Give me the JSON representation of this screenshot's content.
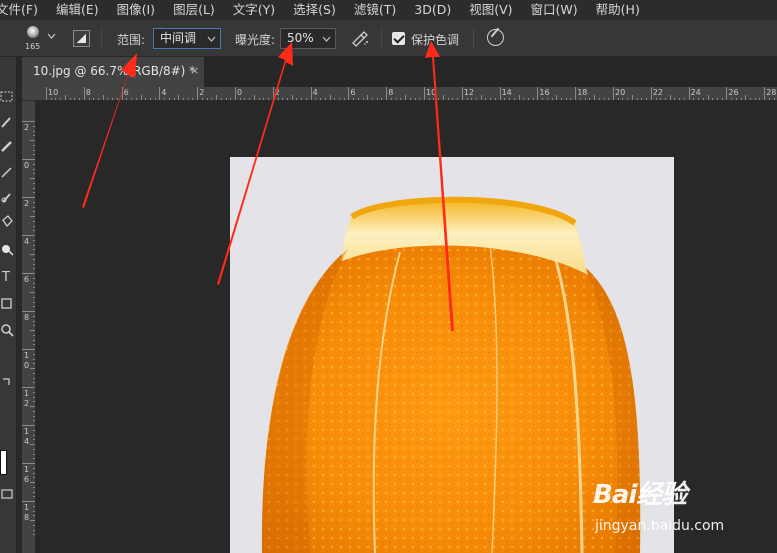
{
  "menu": [
    "文件(F)",
    "编辑(E)",
    "图像(I)",
    "图层(L)",
    "文字(Y)",
    "选择(S)",
    "滤镜(T)",
    "3D(D)",
    "视图(V)",
    "窗口(W)",
    "帮助(H)"
  ],
  "options": {
    "brush_size": "165",
    "range_label": "范围:",
    "range_value": "中间调",
    "exposure_label": "曝光度:",
    "exposure_value": "50%",
    "protect_tones_label": "保护色调",
    "protect_tones_checked": true
  },
  "document": {
    "tab_title": "10.jpg @ 66.7%(RGB/8#) *",
    "close_symbol": "×"
  },
  "ruler": {
    "top_labels": [
      "10",
      "8",
      "6",
      "4",
      "2",
      "0",
      "2",
      "4",
      "6",
      "8",
      "10",
      "12",
      "14",
      "16",
      "18",
      "20",
      "22",
      "24",
      "26",
      "28"
    ],
    "left_labels": [
      "2",
      "0",
      "2",
      "4",
      "6",
      "8",
      "1\n0",
      "1\n2",
      "1\n4",
      "1\n6",
      "1\n8"
    ]
  },
  "watermark": {
    "logo": "Bai经验",
    "url": "jingyan.baidu.com"
  },
  "annotations": {
    "color": "#ff2a1a",
    "arrows": [
      "range-select",
      "exposure-field",
      "protect-tones-checkbox"
    ]
  },
  "icons": [
    "brush-preset-icon",
    "toggle-brush-panel-icon",
    "airbrush-icon",
    "pressure-size-icon"
  ]
}
